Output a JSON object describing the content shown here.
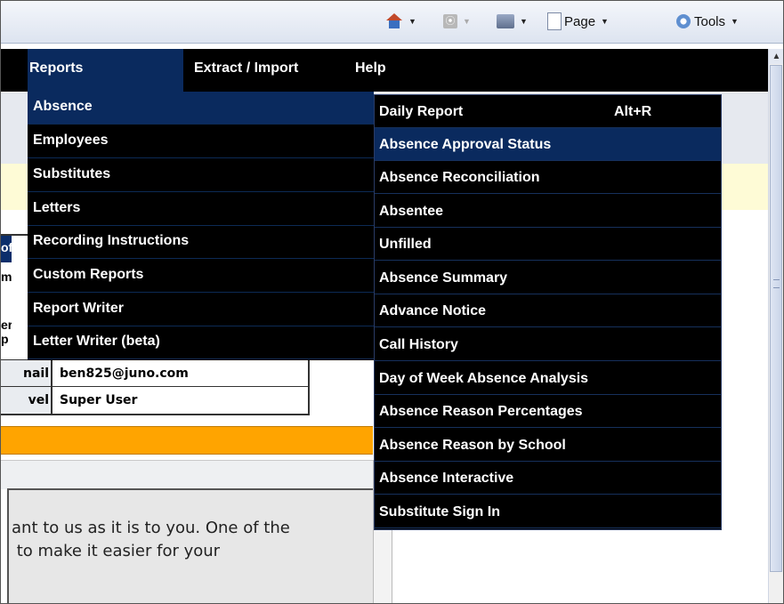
{
  "browser_toolbar": {
    "feed_glyph": "⦿",
    "page_label": "Page",
    "tools_label": "Tools",
    "dropdown_arrow": "▼"
  },
  "menubar": {
    "reports": "Reports",
    "extract_import": "Extract / Import",
    "help": "Help"
  },
  "reports_menu": {
    "items": [
      "Absence",
      "Employees",
      "Substitutes",
      "Letters",
      "Recording Instructions",
      "Custom Reports",
      "Report Writer",
      "Letter Writer (beta)"
    ],
    "active_index": 0
  },
  "absence_submenu": {
    "items": [
      {
        "label": "Daily Report",
        "shortcut": "Alt+R"
      },
      {
        "label": "Absence Approval Status"
      },
      {
        "label": "Absence Reconciliation"
      },
      {
        "label": "Absentee"
      },
      {
        "label": "Unfilled"
      },
      {
        "label": "Absence Summary"
      },
      {
        "label": "Advance Notice"
      },
      {
        "label": "Call History"
      },
      {
        "label": "Day of Week Absence Analysis"
      },
      {
        "label": "Absence Reason Percentages"
      },
      {
        "label": "Absence Reason by School"
      },
      {
        "label": "Absence Interactive"
      },
      {
        "label": "Substitute Sign In"
      }
    ],
    "highlighted_index": 1
  },
  "profile_table": {
    "fragments": [
      "of",
      "m",
      "er",
      "p"
    ],
    "rows": [
      {
        "label": "nail",
        "value": "ben825@juno.com"
      },
      {
        "label": "vel",
        "value": "Super User"
      }
    ]
  },
  "content": {
    "line1": "ant to us as it is to you. One of the",
    "line2": " to make it easier for your"
  },
  "scrollbar": {
    "up_glyph": "▲"
  },
  "colors": {
    "menu_black": "#000000",
    "menu_highlight": "#0a2a5e",
    "orange_bar": "#ffa400",
    "notice_yellow": "#fefbd6"
  }
}
